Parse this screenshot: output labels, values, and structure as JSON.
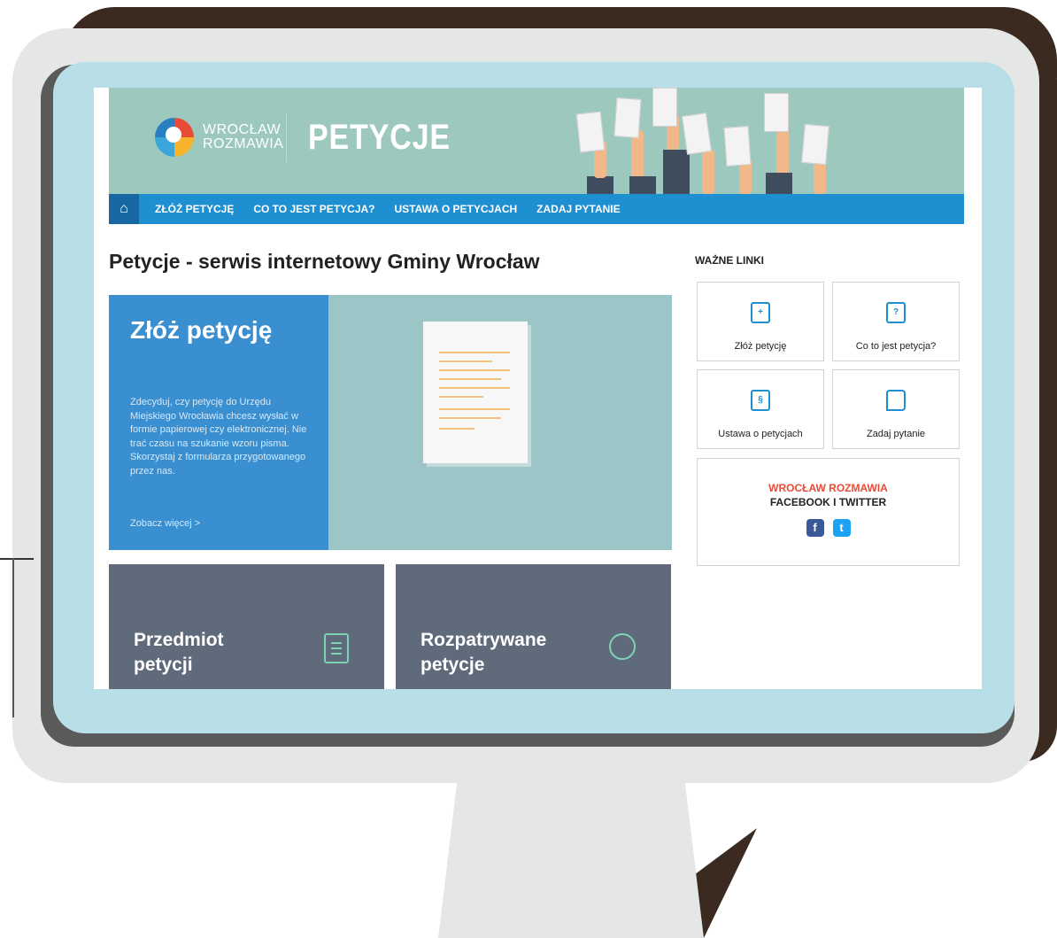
{
  "header": {
    "logo_line1": "WROCŁAW",
    "logo_line2": "ROZMAWIA",
    "brand": "PETYCJE"
  },
  "nav": {
    "home_icon": "home-icon",
    "items": [
      "ZŁÓŻ PETYCJĘ",
      "CO TO JEST PETYCJA?",
      "USTAWA O PETYCJACH",
      "ZADAJ PYTANIE"
    ]
  },
  "main": {
    "title": "Petycje - serwis internetowy Gminy Wrocław",
    "hero": {
      "title": "Złóż petycję",
      "text": "Zdecyduj, czy petycję do Urzędu Miejskiego Wrocławia chcesz wysłać w formie papierowej czy elektronicznej. Nie trać czasu na szukanie wzoru pisma. Skorzystaj z formularza przygotowanego przez nas.",
      "link": "Zobacz więcej >"
    },
    "tiles": [
      {
        "title": "Przedmiot petycji",
        "icon": "document-icon"
      },
      {
        "title": "Rozpatrywane petycje",
        "icon": "search-document-icon"
      }
    ]
  },
  "sidebar": {
    "heading": "WAŻNE LINKI",
    "links": [
      {
        "label": "Złóż petycję",
        "icon": "add-document-icon",
        "glyph": "+"
      },
      {
        "label": "Co to jest petycja?",
        "icon": "question-document-icon",
        "glyph": "?"
      },
      {
        "label": "Ustawa o petycjach",
        "icon": "law-book-icon",
        "glyph": "§"
      },
      {
        "label": "Zadaj pytanie",
        "icon": "chat-bubble-icon",
        "glyph": ""
      }
    ],
    "social": {
      "line1": "WROCŁAW ROZMAWIA",
      "line2": "FACEBOOK I TWITTER",
      "facebook_glyph": "f",
      "twitter_glyph": "t"
    }
  },
  "colors": {
    "header_bg": "#9dc8be",
    "nav_bg": "#1e8fd0",
    "hero_panel": "#3a8fd1",
    "tile_bg": "#5f6b7a",
    "accent_red": "#e94b35",
    "facebook": "#3b5998",
    "twitter": "#1da1f2"
  }
}
